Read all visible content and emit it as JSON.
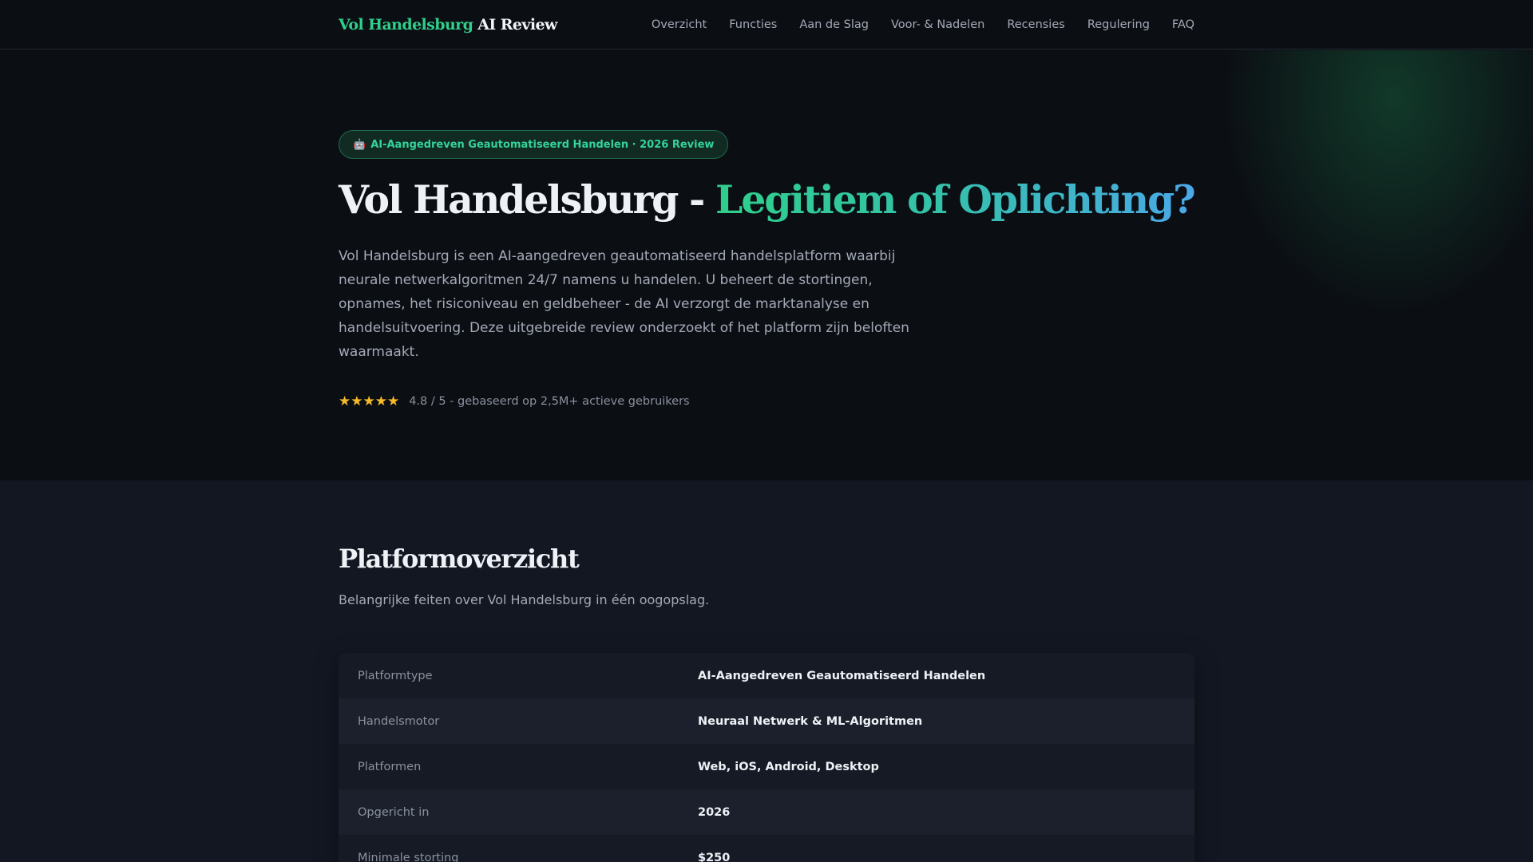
{
  "nav": {
    "brand_accent": "Vol Handelsburg",
    "brand_rest": "AI Review",
    "links": [
      "Overzicht",
      "Functies",
      "Aan de Slag",
      "Voor- & Nadelen",
      "Recensies",
      "Regulering",
      "FAQ"
    ]
  },
  "hero": {
    "badge_icon": "🤖",
    "badge_text": "AI-Aangedreven Geautomatiseerd Handelen · 2026 Review",
    "title_plain": "Vol Handelsburg - ",
    "title_highlight": "Legitiem of Oplichting?",
    "description": "Vol Handelsburg is een AI-aangedreven geautomatiseerd handelsplatform waarbij neurale netwerkalgoritmen 24/7 namens u handelen. U beheert de stortingen, opnames, het risiconiveau en geldbeheer - de AI verzorgt de marktanalyse en handelsuitvoering. Deze uitgebreide review onderzoekt of het platform zijn beloften waarmaakt.",
    "stars": "★★★★★",
    "rating_value": 4.8,
    "rating_max": 5,
    "rating_text": "4.8 / 5 - gebaseerd op 2,5M+ actieve gebruikers"
  },
  "overview": {
    "title": "Platformoverzicht",
    "subtitle": "Belangrijke feiten over Vol Handelsburg in één oogopslag.",
    "facts": [
      {
        "label": "Platformtype",
        "value": "AI-Aangedreven Geautomatiseerd Handelen"
      },
      {
        "label": "Handelsmotor",
        "value": "Neuraal Netwerk & ML-Algoritmen"
      },
      {
        "label": "Platformen",
        "value": "Web, iOS, Android, Desktop"
      },
      {
        "label": "Opgericht in",
        "value": "2026"
      },
      {
        "label": "Minimale storting",
        "value": "$250"
      }
    ]
  },
  "colors": {
    "accent_green": "#2fcf8b",
    "accent_blue": "#4aa8e8",
    "star_gold": "#f5b92a",
    "background": "#0b0e13",
    "section_background": "#131722"
  }
}
